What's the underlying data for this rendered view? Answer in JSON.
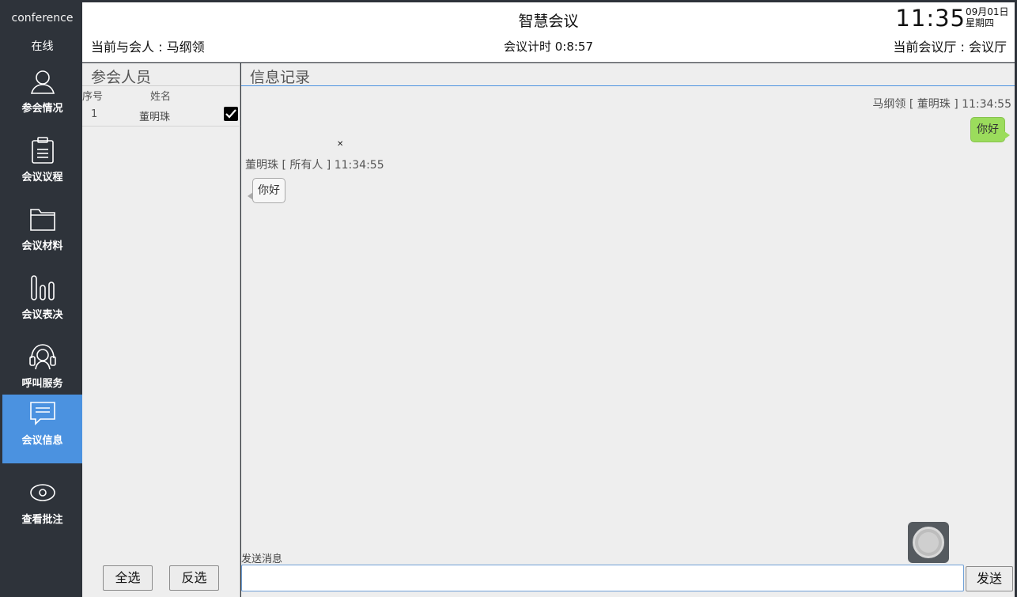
{
  "sidebar": {
    "brand": "conference",
    "status": "在线",
    "items": [
      {
        "label": "参会情况",
        "icon": "person-icon"
      },
      {
        "label": "会议议程",
        "icon": "clipboard-icon"
      },
      {
        "label": "会议材料",
        "icon": "folder-icon"
      },
      {
        "label": "会议表决",
        "icon": "bar-chart-icon"
      },
      {
        "label": "呼叫服务",
        "icon": "headset-icon"
      },
      {
        "label": "会议信息",
        "icon": "message-icon",
        "active": true
      },
      {
        "label": "查看批注",
        "icon": "eye-icon"
      }
    ]
  },
  "header": {
    "title": "智慧会议",
    "attendee": "当前与会人 : 马纲领",
    "timer": "会议计时  0:8:57",
    "room": "当前会议厅 : 会议厅",
    "clock": "11:35",
    "date": "09月01日",
    "weekday": "星期四"
  },
  "participants": {
    "title": "参会人员",
    "col_num": "序号",
    "col_name": "姓名",
    "rows": [
      {
        "num": "1",
        "name": "董明珠",
        "checked": true
      }
    ],
    "select_all": "全选",
    "invert": "反选"
  },
  "messages": {
    "title": "信息记录",
    "items": [
      {
        "meta": "马纲领 [ 董明珠 ] 11:34:55",
        "text": "你好",
        "side": "right"
      },
      {
        "meta": "董明珠 [ 所有人 ] 11:34:55",
        "text": "你好",
        "side": "left"
      }
    ],
    "send_label": "发送消息",
    "input_value": "",
    "send_button": "发送"
  },
  "colors": {
    "sidebar_bg": "#2e333a",
    "active_bg": "#4b92e0",
    "bubble_green": "#9bdc5c"
  }
}
